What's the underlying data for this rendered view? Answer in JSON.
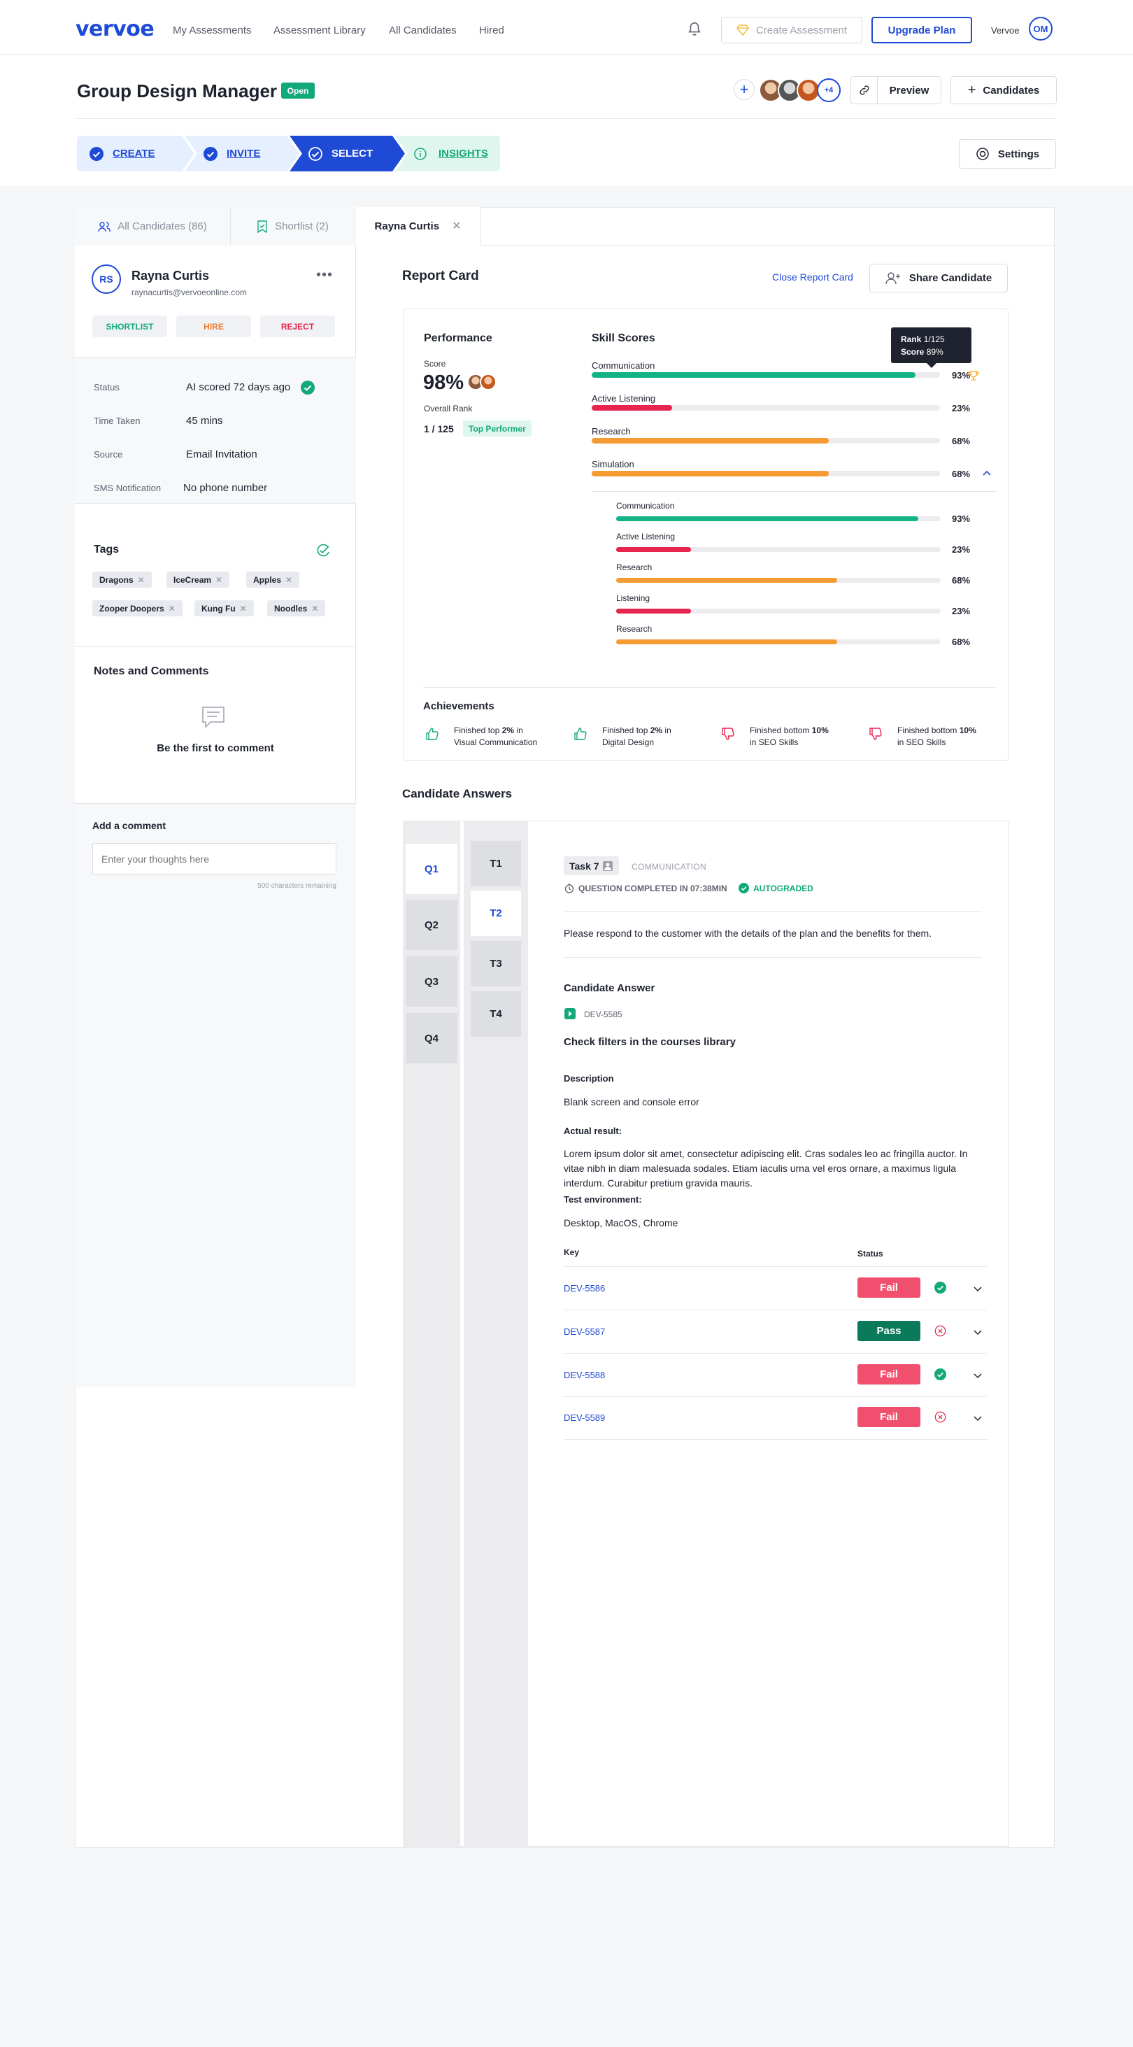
{
  "nav": {
    "logo": "vervoe",
    "links": [
      "My Assessments",
      "Assessment Library",
      "All Candidates",
      "Hired"
    ],
    "create_assessment": "Create Assessment",
    "upgrade": "Upgrade Plan",
    "account": "Vervoe",
    "avatar_initials": "OM"
  },
  "header": {
    "title": "Group Design Manager",
    "status": "Open",
    "collaborators_more": "+4",
    "preview": "Preview",
    "candidates": "Candidates",
    "settings": "Settings",
    "steps": [
      "CREATE",
      "INVITE",
      "SELECT",
      "INSIGHTS"
    ]
  },
  "tabs": [
    "All Candidates (86)",
    "Shortlist (2)",
    "Rayna Curtis"
  ],
  "candidate": {
    "initials": "RS",
    "name": "Rayna Curtis",
    "email": "raynacurtis@vervoeonline.com",
    "actions": [
      "SHORTLIST",
      "HIRE",
      "REJECT"
    ],
    "details": [
      {
        "label": "Status",
        "value": "AI scored 72 days ago"
      },
      {
        "label": "Time Taken",
        "value": "45 mins"
      },
      {
        "label": "Source",
        "value": "Email Invitation"
      },
      {
        "label": "SMS Notification",
        "value": "No phone number"
      }
    ],
    "tags_title": "Tags",
    "tags": [
      "Dragons",
      "IceCream",
      "Apples",
      "Zooper Doopers",
      "Kung Fu",
      "Noodles"
    ],
    "notes_title": "Notes and Comments",
    "notes_empty": "Be the first to comment",
    "comment_label": "Add a comment",
    "comment_placeholder": "Enter your thoughts here",
    "chars_remaining": "500 characters remaining"
  },
  "report": {
    "title": "Report Card",
    "close": "Close Report Card",
    "share": "Share Candidate",
    "performance": "Performance",
    "score_label": "Score",
    "score": "98%",
    "rank_label": "Overall Rank",
    "rank": "1 / 125",
    "rank_badge": "Top Performer",
    "skill_title": "Skill Scores",
    "tooltip_rank_label": "Rank",
    "tooltip_rank": "1/125",
    "tooltip_score_label": "Score",
    "tooltip_score": "89%",
    "skills": [
      {
        "name": "Communication",
        "pct": "93%",
        "value": 0.93,
        "color": "#13b388"
      },
      {
        "name": "Active Listening",
        "pct": "23%",
        "value": 0.23,
        "color": "#e8254e"
      },
      {
        "name": "Research",
        "pct": "68%",
        "value": 0.68,
        "color": "#f59b34"
      },
      {
        "name": "Simulation",
        "pct": "68%",
        "value": 0.68,
        "color": "#f59b34"
      }
    ],
    "subskills": [
      {
        "name": "Communication",
        "pct": "93%",
        "value": 0.93,
        "color": "#13b388"
      },
      {
        "name": "Active Listening",
        "pct": "23%",
        "value": 0.23,
        "color": "#e8254e"
      },
      {
        "name": "Research",
        "pct": "68%",
        "value": 0.68,
        "color": "#f59b34"
      },
      {
        "name": "Listening",
        "pct": "23%",
        "value": 0.23,
        "color": "#e8254e"
      },
      {
        "name": "Research",
        "pct": "68%",
        "value": 0.68,
        "color": "#f59b34"
      }
    ],
    "achievements_title": "Achievements",
    "achievements": [
      {
        "pre": "Finished top ",
        "bold": "2%",
        "post": " in",
        "line2": "Visual Communication",
        "type": "up"
      },
      {
        "pre": "Finished top ",
        "bold": "2%",
        "post": " in",
        "line2": "Digital Design",
        "type": "up"
      },
      {
        "pre": "Finished bottom ",
        "bold": "10%",
        "post": "",
        "line2": "in SEO Skills",
        "type": "down"
      },
      {
        "pre": "Finished bottom ",
        "bold": "10%",
        "post": "",
        "line2": "in SEO Skills",
        "type": "down"
      }
    ]
  },
  "answers": {
    "title": "Candidate Answers",
    "questions": [
      "Q1",
      "Q2",
      "Q3",
      "Q4"
    ],
    "tasks": [
      "T1",
      "T2",
      "T3",
      "T4"
    ],
    "task_label": "Task 7",
    "category": "COMMUNICATION",
    "completed": "QUESTION COMPLETED IN 07:38MIN",
    "autograded": "AUTOGRADED",
    "prompt": "Please respond to the customer with the details of the plan and the benefits for them.",
    "answer_title": "Candidate Answer",
    "ticket": "DEV-5585",
    "ticket_title": "Check filters in the courses library",
    "description_label": "Description",
    "description": "Blank screen and console error",
    "actual_label": "Actual result:",
    "actual_line1": "Lorem ipsum dolor sit amet, consectetur adipiscing elit. Cras sodales leo ac fringilla auctor. In",
    "actual_line2": "vitae nibh in diam malesuada sodales. Etiam iaculis urna vel eros ornare, a maximus ligula",
    "actual_line3": "interdum. Curabitur pretium gravida mauris.",
    "env_label": "Test environment:",
    "env": "Desktop, MacOS, Chrome",
    "col_key": "Key",
    "col_status": "Status",
    "rows": [
      {
        "key": "DEV-5586",
        "status": "Fail",
        "check": "ok"
      },
      {
        "key": "DEV-5587",
        "status": "Pass",
        "check": "x"
      },
      {
        "key": "DEV-5588",
        "status": "Fail",
        "check": "ok"
      },
      {
        "key": "DEV-5589",
        "status": "Fail",
        "check": "x"
      }
    ]
  },
  "colors": {
    "brand": "#1e4ad6",
    "green": "#13a87a",
    "fail": "#f0506e",
    "pass": "#0b7a5a",
    "orange": "#f59b34",
    "red": "#e8254e"
  }
}
